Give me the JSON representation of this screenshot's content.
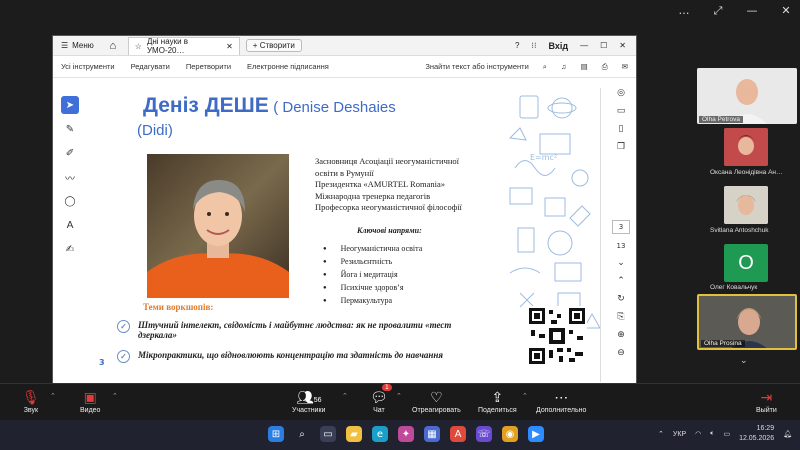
{
  "meeting_window": {
    "controls": [
      "…",
      "⤢",
      "—",
      "✕"
    ]
  },
  "pdf": {
    "menu_label": "Меню",
    "tab_title": "Дні науки в УМО-20…",
    "new_tab_label": "Створити",
    "signin_label": "Вхід",
    "toolbar": [
      "Усі інструменти",
      "Редагувати",
      "Перетворити",
      "Електронне підписання"
    ],
    "search_label": "Знайти текст або інструменти",
    "page_current": "3",
    "page_total": "13"
  },
  "slide": {
    "name_main": "Деніз ДЕШЕ",
    "name_latin": "( Denise Deshaies",
    "nickname": "(Didi)",
    "info_lines": [
      "Засновниця Асоціації неогуманістичної",
      "освіти в Румунії",
      "Президентка «AMURTEL Romania»",
      "Міжнародна тренерка педагогів",
      "Професорка неогуманістичної філософії"
    ],
    "key_directions_title": "Ключові напрями:",
    "key_directions": [
      "Неогуманістична освіта",
      "Резильєнтність",
      "Йога і медитація",
      "Психічне здоров’я",
      "Пермакультура"
    ],
    "topics_title": "Теми воркшопів:",
    "workshop_1": "Штучний інтелект, свідомість і майбутнє людства: як не провалити «тест дзеркала»",
    "workshop_2": "Мікропрактики, що відновлюють концентрацію та здатність до навчання",
    "page_number": "3"
  },
  "participants": {
    "featured_1": "Olha Petrova",
    "small": [
      {
        "name": "Оксана Леонідівна Ан…"
      },
      {
        "name": "Svitlana Antoshchuk"
      },
      {
        "name": "Олег Ковальчук",
        "initial": "О"
      }
    ],
    "featured_2": "Olha Prosina"
  },
  "meeting_bar": {
    "audio": "Звук",
    "video": "Видео",
    "participants": "Участники",
    "participants_count": "56",
    "chat": "Чат",
    "chat_badge": "1",
    "react": "Отреагировать",
    "share": "Поделиться",
    "more": "Дополнительно",
    "leave": "Выйти"
  },
  "taskbar": {
    "lang": "УКР",
    "time": "16:29",
    "date": "12.05.2026"
  },
  "colors": {
    "accent": "#3d6bc6",
    "topics": "#e07a2a",
    "leave": "#e23a3a"
  }
}
